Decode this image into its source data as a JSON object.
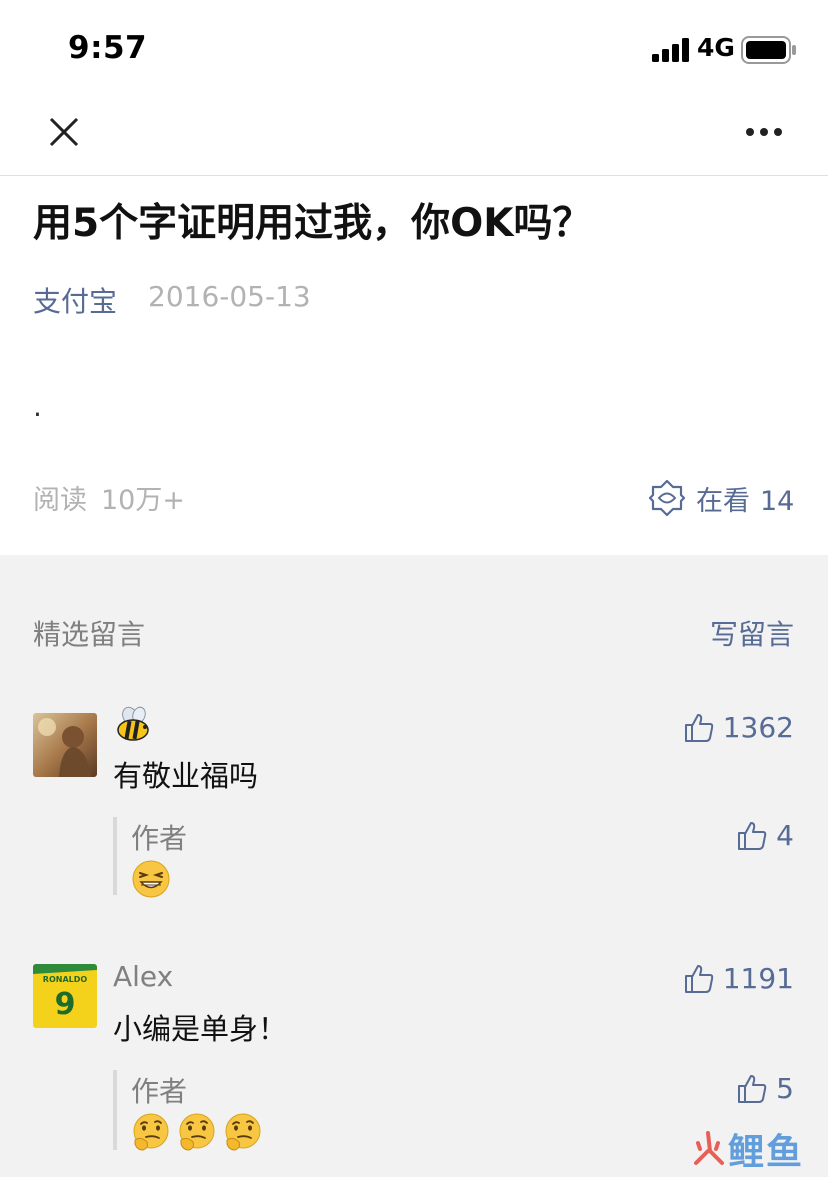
{
  "status_bar": {
    "time": "9:57",
    "network": "4G"
  },
  "article": {
    "title": "用5个字证明用过我，你OK吗？",
    "account": "支付宝",
    "date": "2016-05-13",
    "body": ".",
    "read_label": "阅读",
    "read_count": "10万+",
    "looking_label": "在看",
    "looking_count": "14"
  },
  "comments_section": {
    "title": "精选留言",
    "write_label": "写留言",
    "comments": [
      {
        "name_emoji": "bee",
        "text": "有敬业福吗",
        "likes": "1362",
        "reply": {
          "author": "作者",
          "emojis": [
            "grinning-squint"
          ],
          "likes": "4"
        }
      },
      {
        "name": "Alex",
        "text": "小编是单身！",
        "likes": "1191",
        "reply": {
          "author": "作者",
          "emojis": [
            "thinking",
            "thinking",
            "thinking"
          ],
          "likes": "5"
        }
      }
    ]
  },
  "watermark": {
    "text": "鲤鱼"
  },
  "colors": {
    "link_blue": "#576b95",
    "gray_text": "#b2b2b2",
    "comment_bg": "#f2f2f2"
  }
}
